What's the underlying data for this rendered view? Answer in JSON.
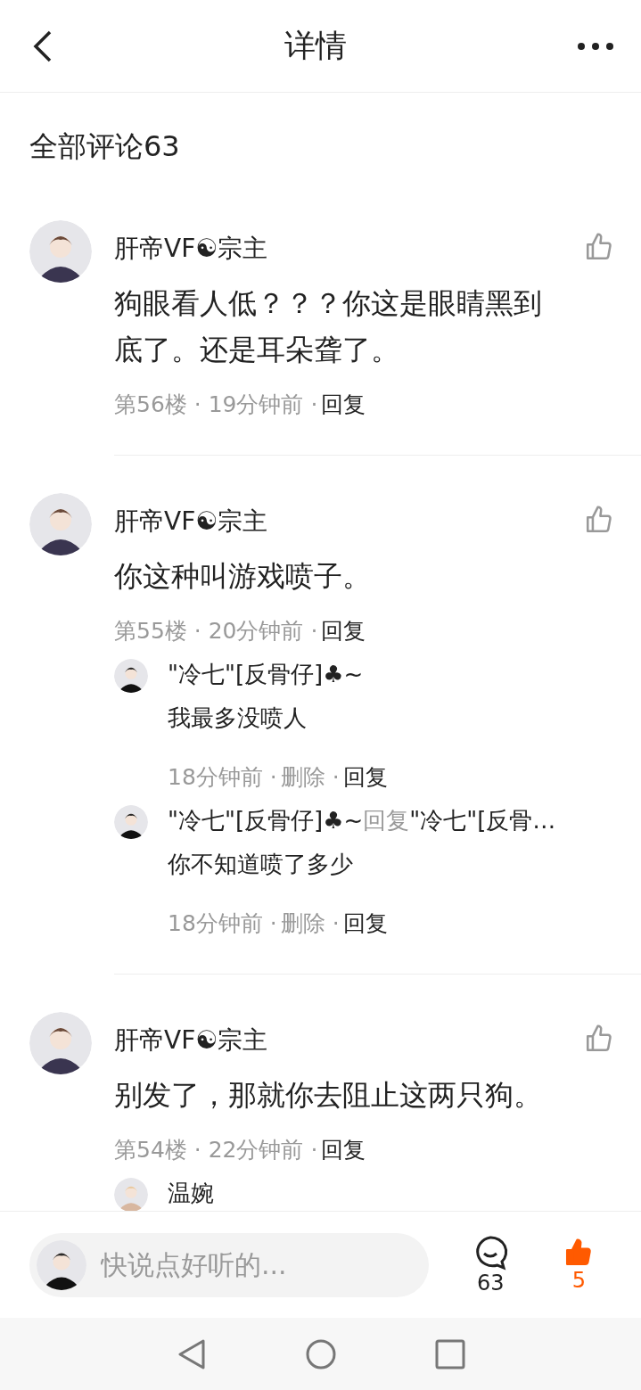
{
  "header": {
    "title": "详情"
  },
  "section_title": "全部评论63",
  "comments": [
    {
      "author": "肝帝VF☯宗主",
      "text": "狗眼看人低？？？你这是眼睛黑到底了。还是耳朵聋了。",
      "meta": "第56楼 · 19分钟前 ·",
      "reply_label": "回复",
      "liked": false
    },
    {
      "author": "肝帝VF☯宗主",
      "text": "你这种叫游戏喷子。",
      "meta": "第55楼 · 20分钟前 ·",
      "reply_label": "回复",
      "liked": false,
      "replies": [
        {
          "author": "\"冷七\"[反骨仔]♣~",
          "text": "我最多没喷人",
          "time": "18分钟前 ·",
          "delete_label": "删除 ·",
          "reply_label": "回复"
        },
        {
          "author": "\"冷七\"[反骨仔]♣~",
          "reply_to_label": "回复",
          "reply_to": "\"冷七\"[反骨…",
          "text": "你不知道喷了多少",
          "time": "18分钟前 ·",
          "delete_label": "删除 ·",
          "reply_label": "回复"
        }
      ]
    },
    {
      "author": "肝帝VF☯宗主",
      "text": "别发了，那就你去阻止这两只狗。",
      "meta": "第54楼 · 22分钟前 ·",
      "reply_label": "回复",
      "liked": false,
      "replies": [
        {
          "author": "温婉"
        }
      ]
    }
  ],
  "bottom_bar": {
    "placeholder": "快说点好听的...",
    "comment_count": "63",
    "like_count": "5",
    "liked": true
  }
}
